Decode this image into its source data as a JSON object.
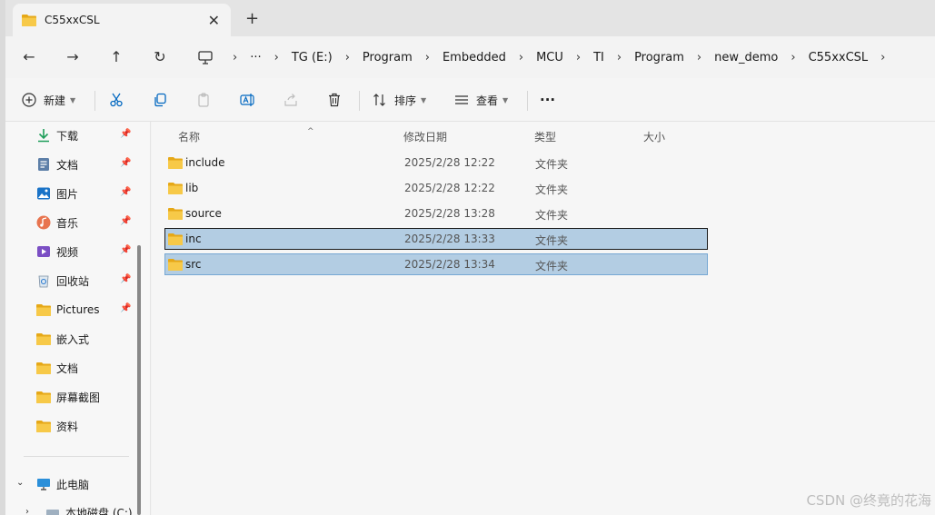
{
  "window": {
    "tab_title": "C55xxCSL",
    "tab_close": "✕",
    "tab_new": "+"
  },
  "nav": {
    "back": "←",
    "forward": "→",
    "up": "↑",
    "refresh": "↻",
    "more": "···"
  },
  "breadcrumbs": [
    "TG (E:)",
    "Program",
    "Embedded",
    "MCU",
    "TI",
    "Program",
    "new_demo",
    "C55xxCSL"
  ],
  "toolbar": {
    "new_label": "新建",
    "sort_label": "排序",
    "view_label": "查看",
    "more_label": "···"
  },
  "sidebar": {
    "items": [
      {
        "label": "下载",
        "icon": "download-icon",
        "pinned": true
      },
      {
        "label": "文档",
        "icon": "document-icon",
        "pinned": true
      },
      {
        "label": "图片",
        "icon": "picture-icon",
        "pinned": true
      },
      {
        "label": "音乐",
        "icon": "music-icon",
        "pinned": true
      },
      {
        "label": "视频",
        "icon": "video-icon",
        "pinned": true
      },
      {
        "label": "回收站",
        "icon": "recycle-bin-icon",
        "pinned": true
      },
      {
        "label": "Pictures",
        "icon": "folder-icon",
        "pinned": true
      },
      {
        "label": "嵌入式",
        "icon": "folder-icon",
        "pinned": false
      },
      {
        "label": "文档",
        "icon": "folder-icon",
        "pinned": false
      },
      {
        "label": "屏幕截图",
        "icon": "folder-icon",
        "pinned": false
      },
      {
        "label": "资料",
        "icon": "folder-icon",
        "pinned": false
      }
    ],
    "this_pc": "此电脑",
    "local_disk": "本地磁盘 (C:)"
  },
  "columns": {
    "name": "名称",
    "date": "修改日期",
    "type": "类型",
    "size": "大小"
  },
  "files": [
    {
      "name": "include",
      "date": "2025/2/28 12:22",
      "type": "文件夹",
      "state": "normal"
    },
    {
      "name": "lib",
      "date": "2025/2/28 12:22",
      "type": "文件夹",
      "state": "normal"
    },
    {
      "name": "source",
      "date": "2025/2/28 13:28",
      "type": "文件夹",
      "state": "normal"
    },
    {
      "name": "inc",
      "date": "2025/2/28 13:33",
      "type": "文件夹",
      "state": "selected-focus"
    },
    {
      "name": "src",
      "date": "2025/2/28 13:34",
      "type": "文件夹",
      "state": "selected"
    }
  ],
  "watermark": "CSDN @终竟的花海",
  "colors": {
    "folder": "#f5c542",
    "selection": "#b3cde3",
    "accent": "#0067c0"
  }
}
